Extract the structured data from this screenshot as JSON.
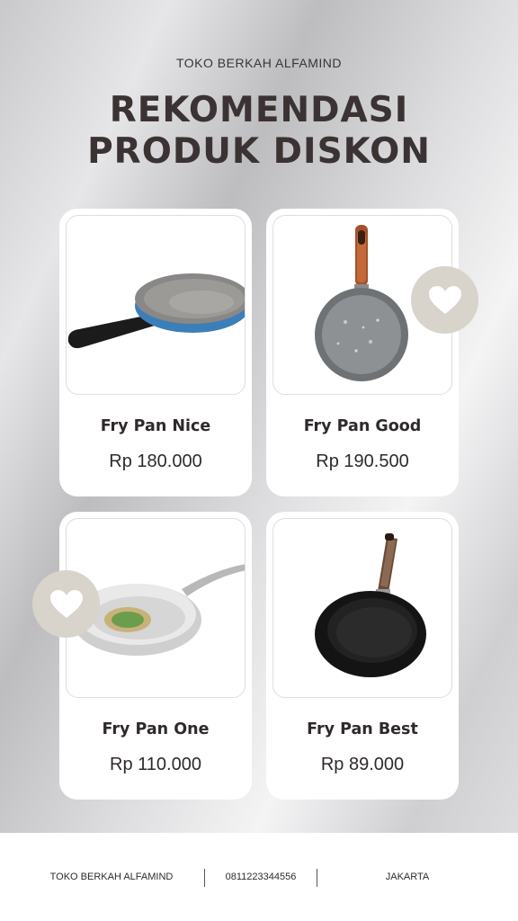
{
  "store_name": "TOKO BERKAH ALFAMIND",
  "headline": {
    "line1": "REKOMENDASI",
    "line2": "PRODUK DISKON"
  },
  "products": [
    {
      "name": "Fry Pan Nice",
      "price": "Rp 180.000",
      "image_icon": "blue-frying-pan-icon"
    },
    {
      "name": "Fry Pan Good",
      "price": "Rp 190.500",
      "image_icon": "granite-frying-pan-icon"
    },
    {
      "name": "Fry Pan One",
      "price": "Rp 110.000",
      "image_icon": "stainless-frying-pan-icon"
    },
    {
      "name": "Fry Pan Best",
      "price": "Rp 89.000",
      "image_icon": "black-frying-pan-icon"
    }
  ],
  "badges": [
    "heart-icon",
    "heart-icon"
  ],
  "colors": {
    "text": "#3b3333",
    "card": "#ffffff",
    "badge": "#d8d3cb"
  },
  "footer": {
    "store": "TOKO BERKAH ALFAMIND",
    "phone": "0811223344556",
    "city": "JAKARTA"
  }
}
